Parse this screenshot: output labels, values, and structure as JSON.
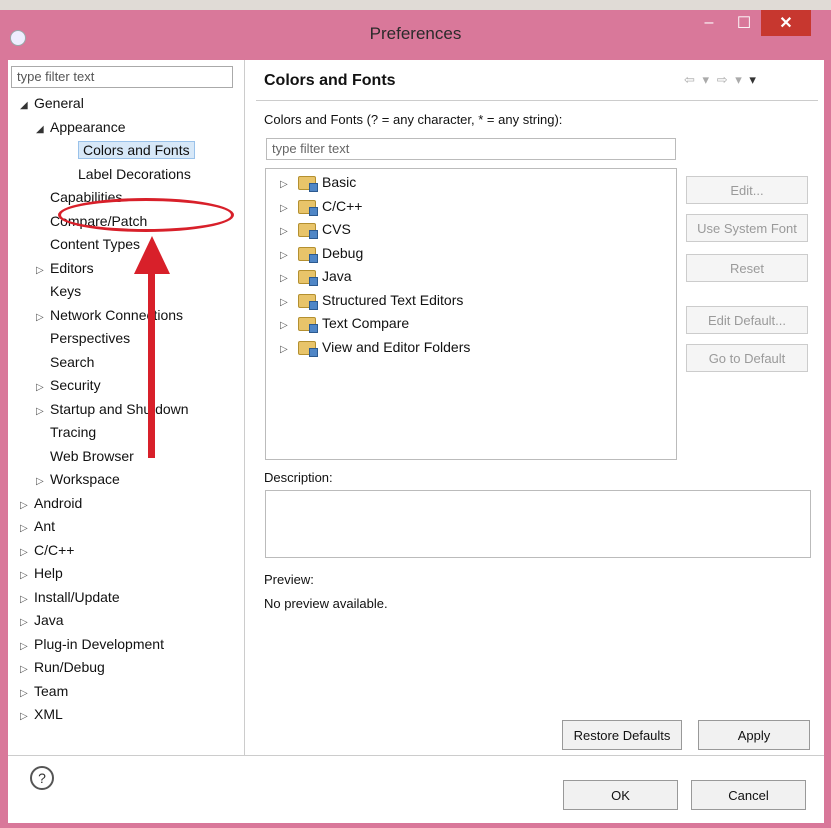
{
  "window": {
    "title": "Preferences",
    "minimize_glyph": "–",
    "maximize_glyph": "☐",
    "close_glyph": "✕",
    "close_color": "#c7372f",
    "frame_color": "#d9789a"
  },
  "left": {
    "filter_placeholder": "type filter text",
    "tree": [
      {
        "label": "General",
        "level": 0,
        "expander": "open"
      },
      {
        "label": "Appearance",
        "level": 1,
        "expander": "open"
      },
      {
        "label": "Colors and Fonts",
        "level": 2,
        "expander": "none",
        "selected": true
      },
      {
        "label": "Label Decorations",
        "level": 2,
        "expander": "none"
      },
      {
        "label": "Capabilities",
        "level": 1,
        "expander": "none"
      },
      {
        "label": "Compare/Patch",
        "level": 1,
        "expander": "none"
      },
      {
        "label": "Content Types",
        "level": 1,
        "expander": "none"
      },
      {
        "label": "Editors",
        "level": 1,
        "expander": "closed"
      },
      {
        "label": "Keys",
        "level": 1,
        "expander": "none"
      },
      {
        "label": "Network Connections",
        "level": 1,
        "expander": "closed"
      },
      {
        "label": "Perspectives",
        "level": 1,
        "expander": "none"
      },
      {
        "label": "Search",
        "level": 1,
        "expander": "none"
      },
      {
        "label": "Security",
        "level": 1,
        "expander": "closed"
      },
      {
        "label": "Startup and Shutdown",
        "level": 1,
        "expander": "closed"
      },
      {
        "label": "Tracing",
        "level": 1,
        "expander": "none"
      },
      {
        "label": "Web Browser",
        "level": 1,
        "expander": "none"
      },
      {
        "label": "Workspace",
        "level": 1,
        "expander": "closed"
      },
      {
        "label": "Android",
        "level": 0,
        "expander": "closed"
      },
      {
        "label": "Ant",
        "level": 0,
        "expander": "closed"
      },
      {
        "label": "C/C++",
        "level": 0,
        "expander": "closed"
      },
      {
        "label": "Help",
        "level": 0,
        "expander": "closed"
      },
      {
        "label": "Install/Update",
        "level": 0,
        "expander": "closed"
      },
      {
        "label": "Java",
        "level": 0,
        "expander": "closed"
      },
      {
        "label": "Plug-in Development",
        "level": 0,
        "expander": "closed"
      },
      {
        "label": "Run/Debug",
        "level": 0,
        "expander": "closed"
      },
      {
        "label": "Team",
        "level": 0,
        "expander": "closed"
      },
      {
        "label": "XML",
        "level": 0,
        "expander": "closed"
      }
    ]
  },
  "right": {
    "title": "Colors and Fonts",
    "subtitle": "Colors and Fonts (? = any character, * = any string):",
    "filter_placeholder": "type filter text",
    "categories": [
      "Basic",
      "C/C++",
      "CVS",
      "Debug",
      "Java",
      "Structured Text Editors",
      "Text Compare",
      "View and Editor Folders"
    ],
    "buttons": {
      "edit": "Edit...",
      "use_system_font": "Use System Font",
      "reset": "Reset",
      "edit_default": "Edit Default...",
      "go_to_default": "Go to Default"
    },
    "description_label": "Description:",
    "preview_label": "Preview:",
    "preview_text": "No preview available.",
    "restore_defaults": "Restore Defaults",
    "apply": "Apply"
  },
  "footer": {
    "help_glyph": "?",
    "ok": "OK",
    "cancel": "Cancel"
  },
  "annotation": {
    "color": "#d8202a"
  }
}
